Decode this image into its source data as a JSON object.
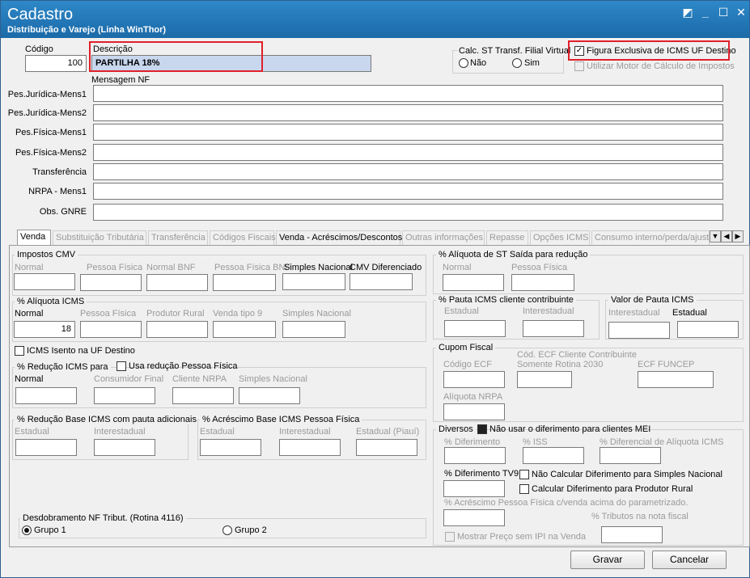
{
  "window": {
    "title": "Cadastro",
    "subtitle": "Distribuição e Varejo (Linha WinThor)"
  },
  "header": {
    "codigo_label": "Código",
    "codigo_value": "100",
    "descricao_label": "Descrição",
    "descricao_value": "PARTILHA 18%",
    "calc_st_label": "Calc. ST Transf. Filial Virtual",
    "radio_nao": "Não",
    "radio_sim": "Sim",
    "figura_exclusiva": "Figura Exclusiva de ICMS UF Destino",
    "utilizar_motor": "Utilizar Motor de Cálculo de Impostos",
    "mensagem_nf": "Mensagem NF"
  },
  "messages": [
    {
      "label": "Pes.Jurídica-Mens1",
      "value": ""
    },
    {
      "label": "Pes.Jurídica-Mens2",
      "value": ""
    },
    {
      "label": "Pes.Física-Mens1",
      "value": ""
    },
    {
      "label": "Pes.Física-Mens2",
      "value": ""
    },
    {
      "label": "Transferência",
      "value": ""
    },
    {
      "label": "NRPA - Mens1",
      "value": ""
    },
    {
      "label": "Obs. GNRE",
      "value": ""
    }
  ],
  "tabs": [
    "Venda",
    "Substituição Tributária",
    "Transferência",
    "Códigos Fiscais",
    "Venda - Acréscimos/Descontos",
    "Outras informações",
    "Repasse",
    "Opções ICMS",
    "Consumo interno/perda/ajuste"
  ],
  "impostos_cmv": {
    "title": "Impostos CMV",
    "labels": [
      "Normal",
      "Pessoa Física",
      "Normal BNF",
      "Pessoa Física BNF",
      "Simples Nacional",
      "CMV Diferenciado"
    ]
  },
  "aliquota_icms": {
    "title": "% Alíquota ICMS",
    "labels": [
      "Normal",
      "Pessoa Física",
      "Produtor Rural",
      "Venda tipo 9",
      "Simples Nacional"
    ],
    "normal_value": "18"
  },
  "icms_isento": "ICMS Isento na UF Destino",
  "reducao_icms": {
    "title": "% Redução ICMS para",
    "usa_reducao": "Usa redução Pessoa Física",
    "labels": [
      "Normal",
      "Consumidor Final",
      "Cliente NRPA",
      "Simples Nacional"
    ]
  },
  "reducao_base": {
    "title": "% Redução Base ICMS com pauta adicionais",
    "labels": [
      "Estadual",
      "Interestadual"
    ]
  },
  "acrescimo_base": {
    "title": "% Acréscimo Base ICMS Pessoa Física",
    "labels": [
      "Estadual",
      "Interestadual",
      "Estadual (Piauí)"
    ]
  },
  "desdobramento": {
    "title": "Desdobramento NF Tribut. (Rotina 4116)",
    "grupo1": "Grupo 1",
    "grupo2": "Grupo 2"
  },
  "aliquota_st": {
    "title": "% Alíquota de ST Saída para redução",
    "labels": [
      "Normal",
      "Pessoa Física"
    ]
  },
  "pauta_icms": {
    "title": "% Pauta ICMS cliente contribuinte",
    "labels": [
      "Estadual",
      "Interestadual"
    ]
  },
  "valor_pauta": {
    "title": "Valor de Pauta ICMS",
    "labels": [
      "Interestadual",
      "Estadual"
    ]
  },
  "cupom_fiscal": {
    "title": "Cupom Fiscal",
    "codigo_ecf": "Código ECF",
    "cod_ecf_cliente_1": "Cód. ECF Cliente Contribuinte",
    "cod_ecf_cliente_2": "Somente Rotina 2030",
    "ecf_funcep": "ECF FUNCEP",
    "aliquota_nrpa": "Alíquota NRPA"
  },
  "diversos": {
    "title": "Diversos",
    "nao_usar_diferimento": "Não usar o diferimento para clientes MEI",
    "diferimento": "% Diferimento",
    "iss": "% ISS",
    "diferencial": "% Diferencial de Alíquota ICMS",
    "diferimento_tv9": "% Diferimento TV9",
    "nao_calcular": "Não Calcular Diferimento para Simples Nacional",
    "calcular_produtor": "Calcular Diferimento para Produtor Rural",
    "acrescimo_pf": "% Acréscimo Pessoa Física c/venda acima do parametrizado.",
    "tributos_nota": "% Tributos na nota fiscal",
    "mostrar_preco": "Mostrar Preço sem IPI na Venda"
  },
  "buttons": {
    "gravar": "Gravar",
    "cancelar": "Cancelar"
  }
}
